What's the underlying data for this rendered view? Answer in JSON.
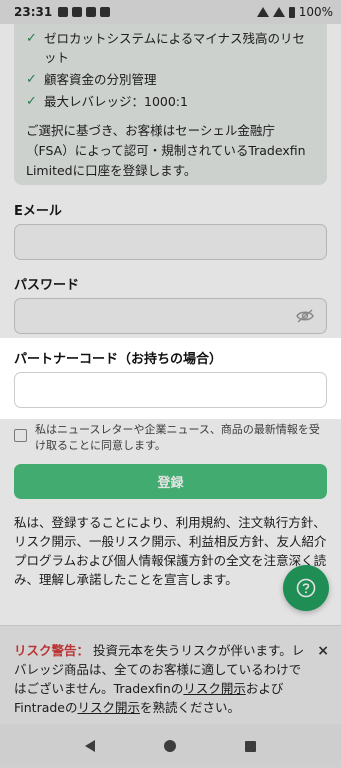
{
  "status_bar": {
    "time": "23:31",
    "battery": "100%"
  },
  "info_card": {
    "features": [
      "ゼロカットシステムによるマイナス残高のリセット",
      "顧客資金の分別管理",
      "最大レバレッジ：1000:1"
    ],
    "regulation_note": "ご選択に基づき、お客様はセーシェル金融庁（FSA）によって認可・規制されているTradexfin Limitedに口座を登録します。"
  },
  "form": {
    "email_label": "Eメール",
    "email_value": "",
    "password_label": "パスワード",
    "password_value": "",
    "partner_code_label": "パートナーコード（お持ちの場合）",
    "partner_code_value": "",
    "consent_text": "私はニュースレターや企業ニュース、商品の最新情報を受け取ることに同意します。",
    "register_label": "登録"
  },
  "terms_text": "私は、登録することにより、利用規約、注文執行方針、リスク開示、一般リスク開示、利益相反方針、友人紹介プログラムおよび個人情報保護方針の全文を注意深く読み、理解し承諾したことを宣言します。",
  "help_button_icon": "question-icon",
  "risk_warning": {
    "title": "リスク警告：",
    "text_1": "投資元本を失うリスクが伴います。レバレッジ商品は、全てのお客様に適しているわけではございません。TradexfinのLink",
    "part_a": " 投資元本を失うリスクが伴います。レバレッジ商品は、全てのお客様に適しているわけではございません。Tradexfinの",
    "link_1": "リスク開示",
    "part_b": "およびFintradeの",
    "link_2": "リスク開示",
    "part_c": "を熟読ください。",
    "close": "×"
  },
  "colors": {
    "accent_green": "#49c07e",
    "fab_green": "#22a05f",
    "risk_red": "#d33a3a"
  }
}
